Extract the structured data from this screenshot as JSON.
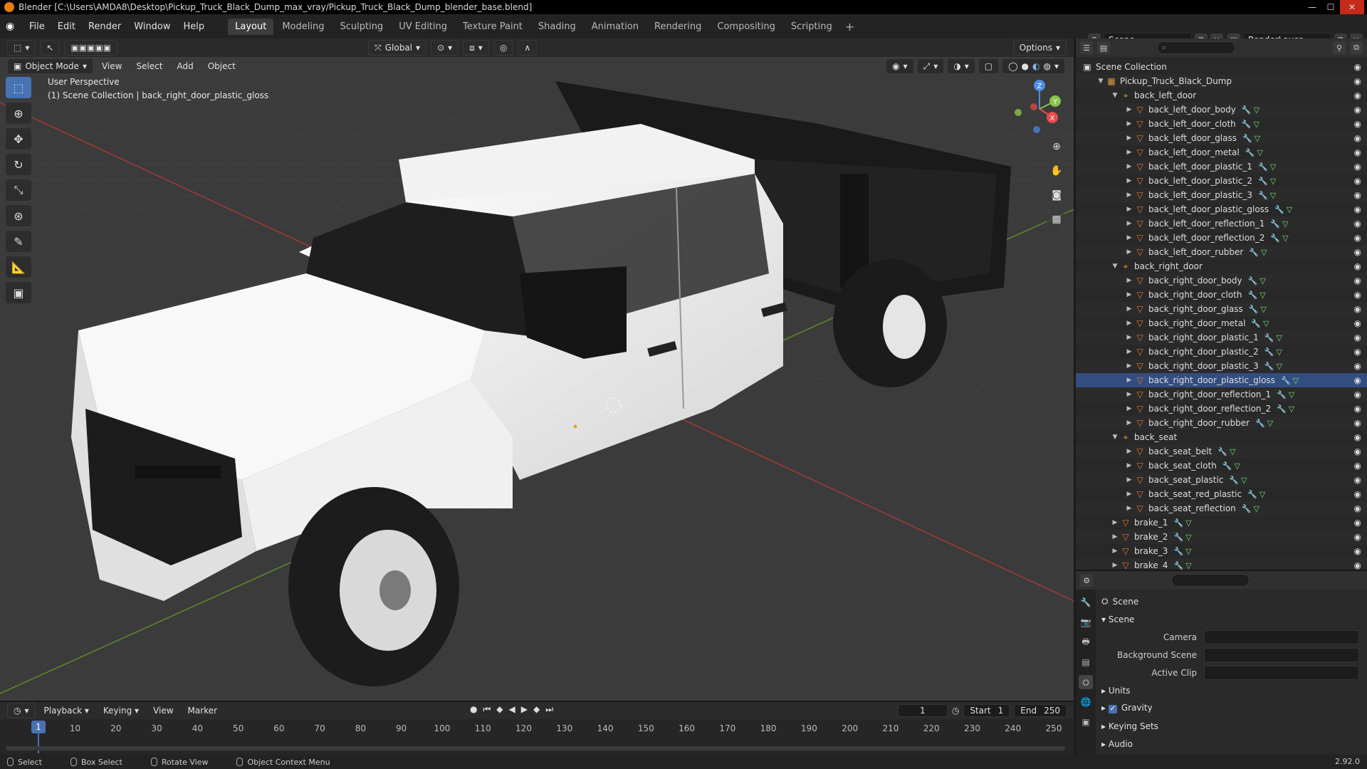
{
  "title_bar": {
    "text": "Blender [C:\\Users\\AMDA8\\Desktop\\Pickup_Truck_Black_Dump_max_vray/Pickup_Truck_Black_Dump_blender_base.blend]"
  },
  "menu": {
    "file": "File",
    "edit": "Edit",
    "render": "Render",
    "window": "Window",
    "help": "Help"
  },
  "workspaces": [
    "Layout",
    "Modeling",
    "Sculpting",
    "UV Editing",
    "Texture Paint",
    "Shading",
    "Animation",
    "Rendering",
    "Compositing",
    "Scripting"
  ],
  "active_workspace": "Layout",
  "scene_name": "Scene",
  "render_layer": "RenderLayer",
  "viewport": {
    "transform_orientation": "Global",
    "options_label": "Options",
    "mode": "Object Mode",
    "menus": {
      "view": "View",
      "select": "Select",
      "add": "Add",
      "object": "Object"
    },
    "info_line1": "User Perspective",
    "info_line2": "(1) Scene Collection | back_right_door_plastic_gloss",
    "gizmo": {
      "x": "X",
      "y": "Y",
      "z": "Z"
    }
  },
  "outliner": {
    "root": "Scene Collection",
    "items": [
      {
        "depth": 1,
        "type": "collection",
        "name": "Pickup_Truck_Black_Dump",
        "open": true
      },
      {
        "depth": 2,
        "type": "empty",
        "name": "back_left_door",
        "open": true
      },
      {
        "depth": 3,
        "type": "mesh",
        "name": "back_left_door_body"
      },
      {
        "depth": 3,
        "type": "mesh",
        "name": "back_left_door_cloth"
      },
      {
        "depth": 3,
        "type": "mesh",
        "name": "back_left_door_glass"
      },
      {
        "depth": 3,
        "type": "mesh",
        "name": "back_left_door_metal"
      },
      {
        "depth": 3,
        "type": "mesh",
        "name": "back_left_door_plastic_1"
      },
      {
        "depth": 3,
        "type": "mesh",
        "name": "back_left_door_plastic_2"
      },
      {
        "depth": 3,
        "type": "mesh",
        "name": "back_left_door_plastic_3"
      },
      {
        "depth": 3,
        "type": "mesh",
        "name": "back_left_door_plastic_gloss"
      },
      {
        "depth": 3,
        "type": "mesh",
        "name": "back_left_door_reflection_1"
      },
      {
        "depth": 3,
        "type": "mesh",
        "name": "back_left_door_reflection_2"
      },
      {
        "depth": 3,
        "type": "mesh",
        "name": "back_left_door_rubber"
      },
      {
        "depth": 2,
        "type": "empty",
        "name": "back_right_door",
        "open": true
      },
      {
        "depth": 3,
        "type": "mesh",
        "name": "back_right_door_body"
      },
      {
        "depth": 3,
        "type": "mesh",
        "name": "back_right_door_cloth"
      },
      {
        "depth": 3,
        "type": "mesh",
        "name": "back_right_door_glass"
      },
      {
        "depth": 3,
        "type": "mesh",
        "name": "back_right_door_metal"
      },
      {
        "depth": 3,
        "type": "mesh",
        "name": "back_right_door_plastic_1"
      },
      {
        "depth": 3,
        "type": "mesh",
        "name": "back_right_door_plastic_2"
      },
      {
        "depth": 3,
        "type": "mesh",
        "name": "back_right_door_plastic_3"
      },
      {
        "depth": 3,
        "type": "mesh",
        "name": "back_right_door_plastic_gloss",
        "selected": true
      },
      {
        "depth": 3,
        "type": "mesh",
        "name": "back_right_door_reflection_1"
      },
      {
        "depth": 3,
        "type": "mesh",
        "name": "back_right_door_reflection_2"
      },
      {
        "depth": 3,
        "type": "mesh",
        "name": "back_right_door_rubber"
      },
      {
        "depth": 2,
        "type": "empty",
        "name": "back_seat",
        "open": true
      },
      {
        "depth": 3,
        "type": "mesh",
        "name": "back_seat_belt"
      },
      {
        "depth": 3,
        "type": "mesh",
        "name": "back_seat_cloth"
      },
      {
        "depth": 3,
        "type": "mesh",
        "name": "back_seat_plastic"
      },
      {
        "depth": 3,
        "type": "mesh",
        "name": "back_seat_red_plastic"
      },
      {
        "depth": 3,
        "type": "mesh",
        "name": "back_seat_reflection"
      },
      {
        "depth": 2,
        "type": "mesh",
        "name": "brake_1"
      },
      {
        "depth": 2,
        "type": "mesh",
        "name": "brake_2"
      },
      {
        "depth": 2,
        "type": "mesh",
        "name": "brake_3"
      },
      {
        "depth": 2,
        "type": "mesh",
        "name": "brake_4"
      }
    ]
  },
  "properties": {
    "context": "Scene",
    "panel": "Scene",
    "camera_label": "Camera",
    "background_scene_label": "Background Scene",
    "active_clip_label": "Active Clip",
    "sections": [
      "Units",
      "Gravity",
      "Keying Sets",
      "Audio"
    ],
    "gravity_checked": true
  },
  "timeline": {
    "menus": {
      "playback": "Playback",
      "keying": "Keying",
      "view": "View",
      "marker": "Marker"
    },
    "current_frame": "1",
    "start_label": "Start",
    "start": "1",
    "end_label": "End",
    "end": "250",
    "ruler_ticks": [
      "10",
      "20",
      "30",
      "40",
      "50",
      "60",
      "70",
      "80",
      "90",
      "100",
      "110",
      "120",
      "130",
      "140",
      "150",
      "160",
      "170",
      "180",
      "190",
      "200",
      "210",
      "220",
      "230",
      "240",
      "250"
    ],
    "cursor_frame": "1"
  },
  "status": {
    "select": "Select",
    "box_select": "Box Select",
    "rotate_view": "Rotate View",
    "context_menu": "Object Context Menu",
    "version": "2.92.0"
  },
  "colors": {
    "accent": "#4772b3",
    "collection": "#e09a3a",
    "mesh": "#e07a30",
    "modifier": "#6ac3e8",
    "data": "#6fe06f",
    "axis_x": "#e44d4d",
    "axis_y": "#8bc34a",
    "axis_z": "#4d8fe4"
  }
}
